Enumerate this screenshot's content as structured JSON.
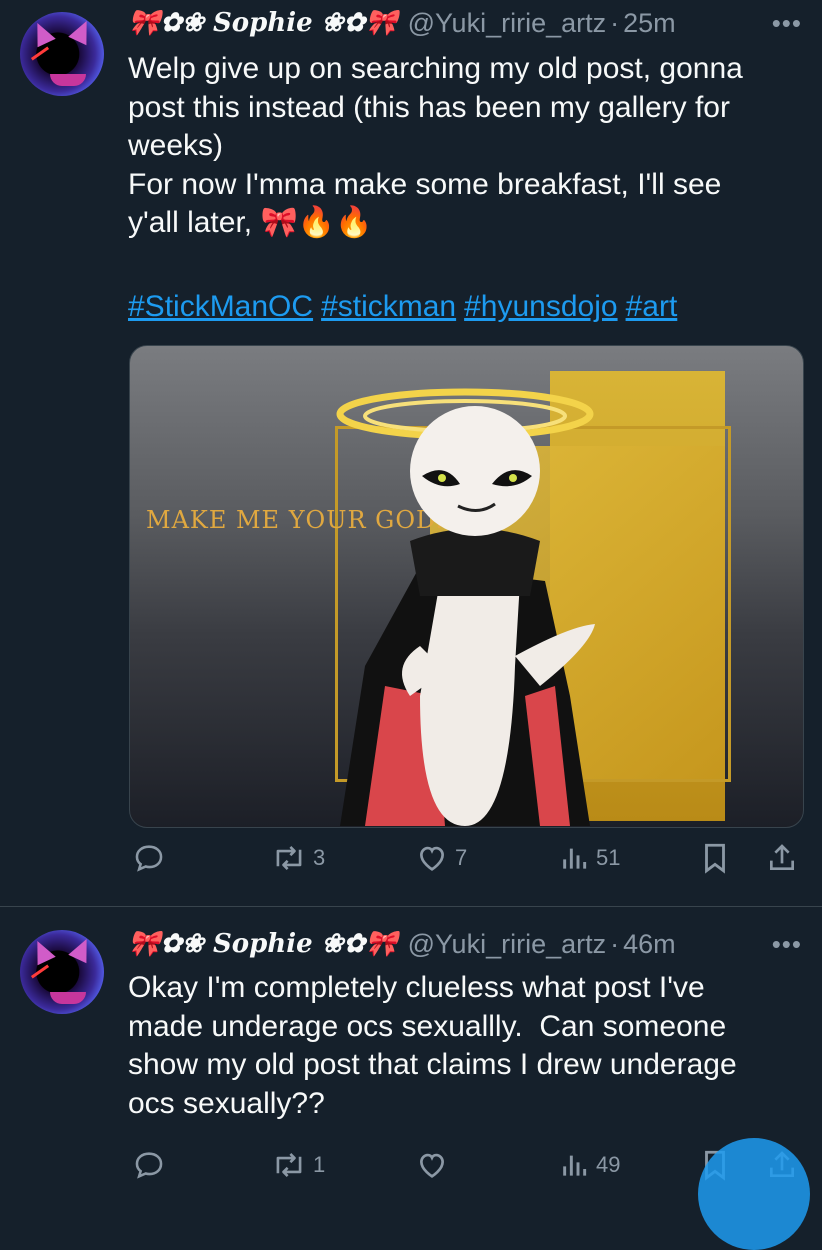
{
  "tweets": [
    {
      "author": {
        "display_name": "🎀✿❀ Sophie ❀✿🎀",
        "handle": "@Yuki_ririe_artz",
        "time": "25m"
      },
      "text": "Welp give up on searching my old post, gonna\npost this instead (this has been my gallery for\nweeks)\nFor now I'mma make some breakfast, I'll see\ny'all later, 🎀🔥🔥",
      "hashtags": [
        "#StickManOC",
        "#stickman",
        "#hyunsdojo",
        "#art"
      ],
      "media": {
        "caption": "MAKE ME YOUR GOD."
      },
      "stats": {
        "replies": "",
        "retweets": "3",
        "likes": "7",
        "views": "51"
      }
    },
    {
      "author": {
        "display_name": "🎀✿❀ Sophie ❀✿🎀",
        "handle": "@Yuki_ririe_artz",
        "time": "46m"
      },
      "text": "Okay I'm completely clueless what post I've\nmade underage ocs sexuallly.  Can someone\nshow my old post that claims I drew underage\nocs sexually??",
      "stats": {
        "replies": "",
        "retweets": "1",
        "likes": "",
        "views": "49"
      }
    }
  ],
  "ui": {
    "more_label": "•••",
    "separator": "·"
  },
  "colors": {
    "background": "#15202b",
    "accent": "#1d9bf0",
    "secondary_text": "#8b98a5",
    "divider": "#38444d"
  }
}
